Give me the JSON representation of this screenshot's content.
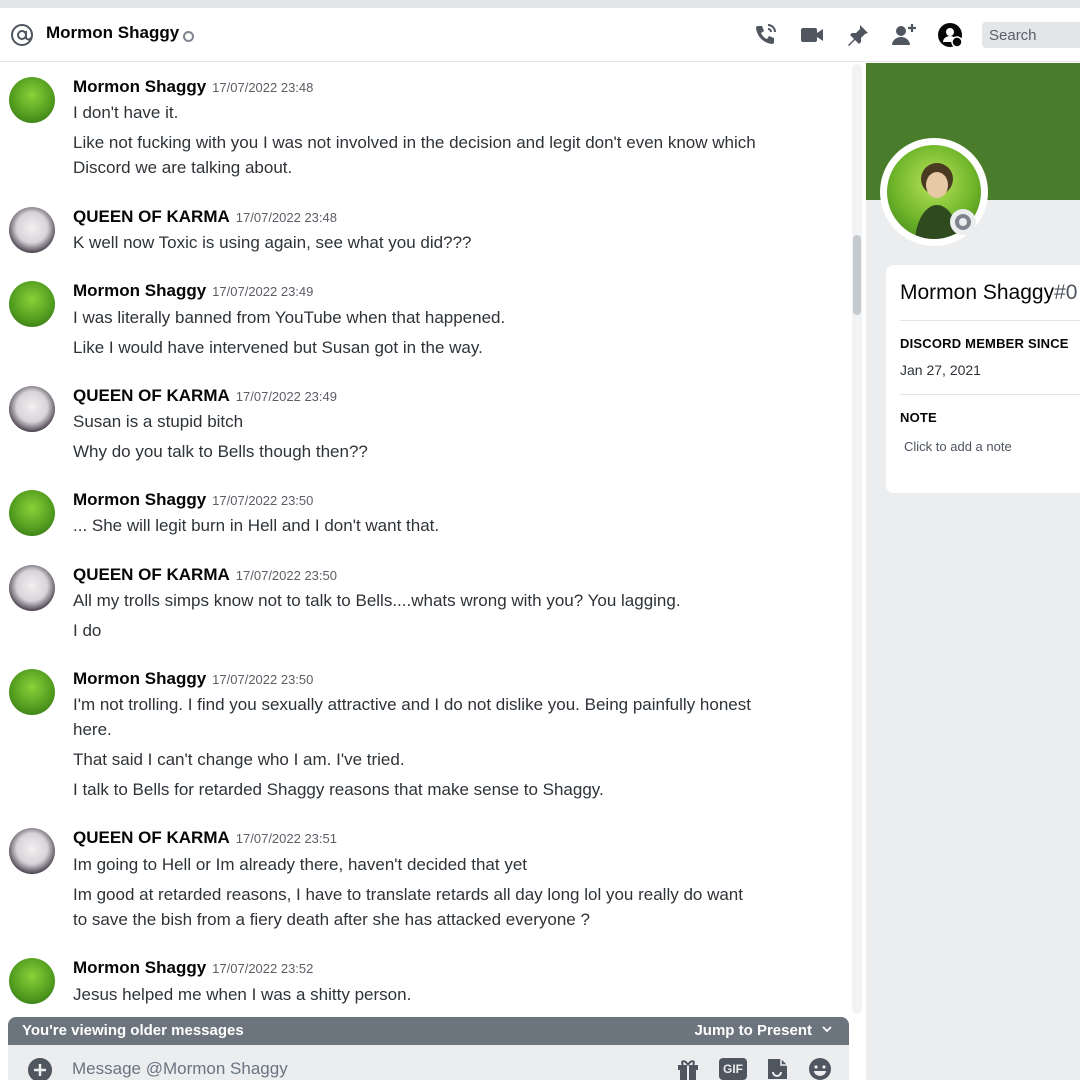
{
  "header": {
    "title": "Mormon Shaggy",
    "search_placeholder": "Search",
    "icons": [
      "at-icon",
      "status-offline-icon",
      "voice-call-icon",
      "video-call-icon",
      "pin-icon",
      "add-friend-icon",
      "user-profile-icon"
    ]
  },
  "messages": [
    {
      "author": "Mormon Shaggy",
      "timestamp": "17/07/2022 23:48",
      "lines": [
        "I don't have it.",
        "Like not fucking with you I was not involved in the decision and legit don't even know which",
        "Discord we are talking about."
      ]
    },
    {
      "author": "QUEEN OF KARMA",
      "timestamp": "17/07/2022 23:48",
      "lines": [
        "K well now Toxic is using again, see what you did???"
      ]
    },
    {
      "author": "Mormon Shaggy",
      "timestamp": "17/07/2022 23:49",
      "lines": [
        "I was literally banned from YouTube when that happened.",
        "Like I would have intervened but Susan got in the way."
      ]
    },
    {
      "author": "QUEEN OF KARMA",
      "timestamp": "17/07/2022 23:49",
      "lines": [
        "Susan is a stupid bitch",
        "Why do you talk to Bells though then??"
      ]
    },
    {
      "author": "Mormon Shaggy",
      "timestamp": "17/07/2022 23:50",
      "lines": [
        "... She will legit burn in Hell and I don't want that."
      ]
    },
    {
      "author": "QUEEN OF KARMA",
      "timestamp": "17/07/2022 23:50",
      "lines": [
        "All my trolls simps know not to talk to Bells....whats wrong with you? You lagging.",
        "I do"
      ]
    },
    {
      "author": "Mormon Shaggy",
      "timestamp": "17/07/2022 23:50",
      "lines": [
        "I'm not trolling. I find you sexually attractive and I do not dislike you. Being painfully honest",
        "here.",
        "That said I can't change who I am. I've tried.",
        "I talk to Bells for retarded Shaggy reasons that make sense to Shaggy."
      ]
    },
    {
      "author": "QUEEN OF KARMA",
      "timestamp": "17/07/2022 23:51",
      "lines": [
        "Im going to Hell or Im already there, haven't decided that yet",
        "Im good at retarded reasons, I have to translate retards all day long lol you really do want",
        "to save the bish from a fiery death after she has attacked everyone ?"
      ]
    },
    {
      "author": "Mormon Shaggy",
      "timestamp": "17/07/2022 23:52",
      "lines": [
        "Jesus helped me when I was a shitty person."
      ]
    }
  ],
  "older_bar": {
    "label": "You're viewing older messages",
    "jump_label": "Jump to Present"
  },
  "composer": {
    "placeholder": "Message @Mormon Shaggy",
    "gif_label": "GIF"
  },
  "profile": {
    "name": "Mormon Shaggy",
    "discriminator": "#0",
    "member_since_label": "DISCORD MEMBER SINCE",
    "member_since_value": "Jan 27, 2021",
    "note_label": "NOTE",
    "note_placeholder": "Click to add a note",
    "banner_color": "#4a7d2b"
  },
  "colors": {
    "text_primary": "#060607",
    "text_body": "#2e3338",
    "muted": "#5c5e66",
    "older_bar": "#6c757e"
  }
}
